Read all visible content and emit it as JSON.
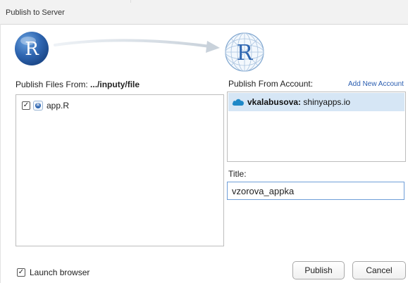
{
  "window": {
    "title": "Publish to Server"
  },
  "publish_from": {
    "label_prefix": "Publish Files From:",
    "path": ".../inputy/file",
    "files": [
      {
        "name": "app.R",
        "checked": true,
        "icon": "r-file-icon"
      }
    ]
  },
  "accounts": {
    "label": "Publish From Account:",
    "add_link": "Add New Account",
    "items": [
      {
        "user": "vkalabusova:",
        "server": "shinyapps.io",
        "icon": "cloud-icon",
        "selected": true
      }
    ]
  },
  "title_field": {
    "label": "Title:",
    "value": "vzorova_appka"
  },
  "footer": {
    "launch_browser": {
      "label": "Launch browser",
      "checked": true
    },
    "publish_button": "Publish",
    "cancel_button": "Cancel"
  },
  "colors": {
    "selection": "#d6e6f5",
    "accent_link": "#2a5db0",
    "r_logo_blue": "#2f66b1",
    "cloud": "#1e88c7"
  }
}
